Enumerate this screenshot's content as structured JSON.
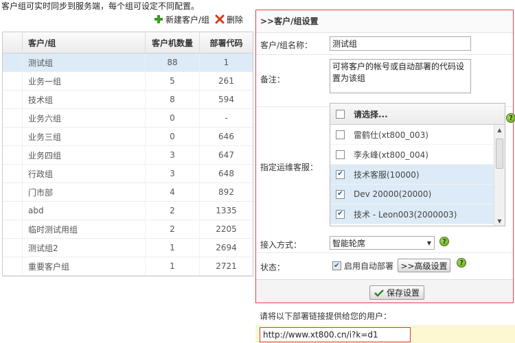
{
  "top_note": "客户组可实时同步到服务端，每个组可设定不同配置。",
  "toolbar": {
    "new_label": "新建客户/组",
    "delete_label": "删除"
  },
  "table": {
    "headers": [
      "客户/组",
      "客户机数量",
      "部署代码"
    ],
    "rows": [
      {
        "name": "测试组",
        "count": "88",
        "code": "1",
        "selected": true
      },
      {
        "name": "业务一组",
        "count": "5",
        "code": "261"
      },
      {
        "name": "技术组",
        "count": "8",
        "code": "594"
      },
      {
        "name": "业务六组",
        "count": "0",
        "code": "-"
      },
      {
        "name": "业务三组",
        "count": "0",
        "code": "646"
      },
      {
        "name": "业务四组",
        "count": "3",
        "code": "647"
      },
      {
        "name": "行政组",
        "count": "3",
        "code": "648"
      },
      {
        "name": "门市部",
        "count": "4",
        "code": "892"
      },
      {
        "name": "abd",
        "count": "2",
        "code": "1335"
      },
      {
        "name": "临时测试用组",
        "count": "2",
        "code": "2205"
      },
      {
        "name": "测试组2",
        "count": "1",
        "code": "2694"
      },
      {
        "name": "重要客户组",
        "count": "1",
        "code": "2721"
      }
    ]
  },
  "panel": {
    "title": ">>客户/组设置",
    "name_label": "客户/组名称：",
    "name_value": "测试组",
    "remark_label": "备注：",
    "remark_value": "可将客户的帐号或自动部署的代码设置为该组",
    "agent_label": "指定运维客服：",
    "agent_header": "请选择...",
    "agents": [
      {
        "label": "雷鹤仕(xt800_003)",
        "checked": false
      },
      {
        "label": "李永峰(xt800_004)",
        "checked": false
      },
      {
        "label": "技术客服(10000)",
        "checked": true
      },
      {
        "label": "Dev 20000(20000)",
        "checked": true
      },
      {
        "label": "技术 - Leon003(2000003)",
        "checked": true
      }
    ],
    "access_label": "接入方式：",
    "access_value": "智能轮席",
    "status_label": "状态：",
    "auto_deploy_label": "启用自动部署",
    "auto_deploy_checked": true,
    "advanced_label": ">>高级设置",
    "save_label": "保存设置"
  },
  "link_note": "请将以下部署链接提供给您的用户：",
  "link_value": "http://www.xt800.cn/i?k=d1",
  "colors": {
    "selected_row": "#dcebf7",
    "panel_border": "#dd4444",
    "help_green": "#5a9a1a",
    "link_strip": "#fdf7d2"
  }
}
